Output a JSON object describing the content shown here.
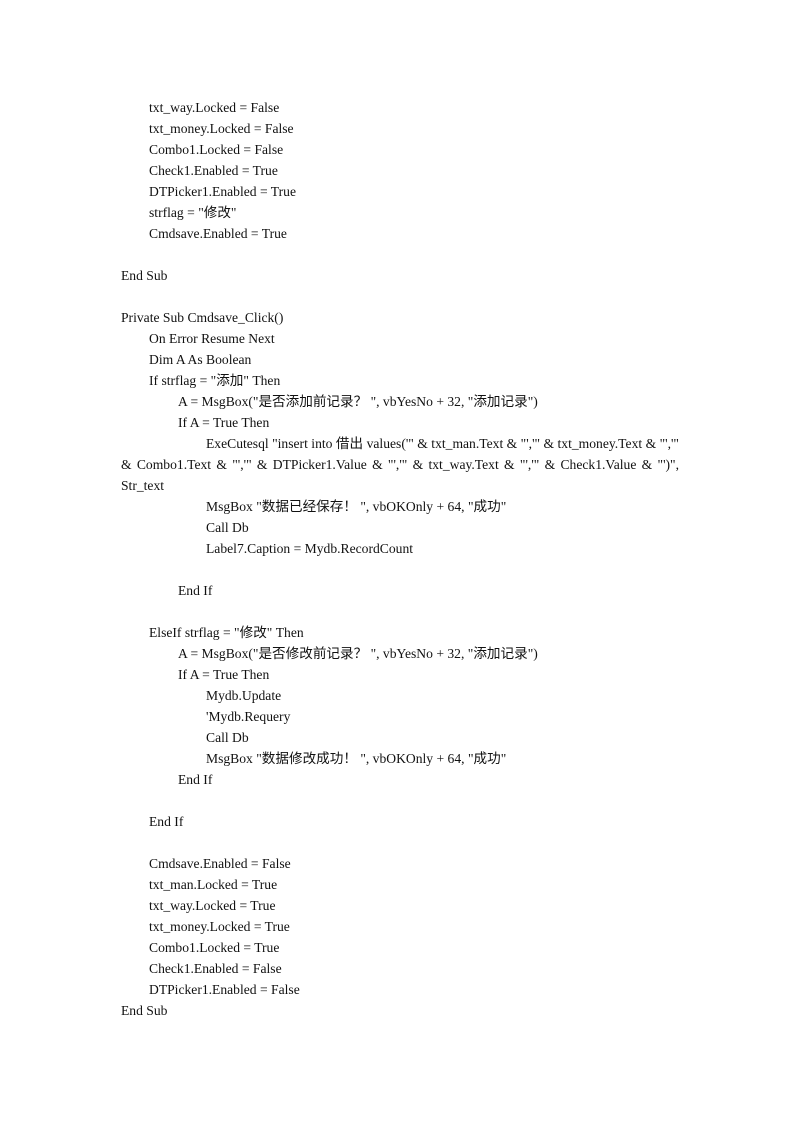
{
  "document": {
    "block1": [
      "txt_way.Locked = False",
      "txt_money.Locked = False",
      "Combo1.Locked = False",
      "Check1.Enabled = True",
      "DTPicker1.Enabled = True",
      "strflag = \"修改\"",
      "Cmdsave.Enabled = True"
    ],
    "end_sub_1": "End Sub",
    "sub_header": "Private Sub Cmdsave_Click()",
    "on_error": "On Error Resume Next",
    "dim_a": "Dim A As Boolean",
    "if_add": "If strflag = \"添加\" Then",
    "msgbox_add_prompt": "A = MsgBox(\"是否添加前记录？ \", vbYesNo + 32, \"添加记录\")",
    "if_a_true_1": "If A = True Then",
    "execute_sql": "ExeCutesql \"insert into  借出  values('\" & txt_man.Text & \"','\" & txt_money.Text & \"','\" & Combo1.Text & \"','\" & DTPicker1.Value & \"','\" & txt_way.Text & \"','\" & Check1.Value & \"')\", Str_text",
    "msgbox_saved": "MsgBox \"数据已经保存！ \", vbOKOnly + 64, \"成功\"",
    "call_db_1": "Call Db",
    "label7_caption": "Label7.Caption = Mydb.RecordCount",
    "end_if_inner_1": "End If",
    "elseif_modify": "ElseIf strflag = \"修改\" Then",
    "msgbox_modify_prompt": "A = MsgBox(\"是否修改前记录？ \", vbYesNo + 32, \"添加记录\")",
    "if_a_true_2": "If A = True Then",
    "mydb_update": "Mydb.Update",
    "mydb_requery_comment": "'Mydb.Requery",
    "call_db_2": "Call Db",
    "msgbox_modified": "MsgBox \"数据修改成功！ \", vbOKOnly + 64, \"成功\"",
    "end_if_inner_2": "End If",
    "end_if_outer": "End If",
    "block2": [
      "Cmdsave.Enabled = False",
      "txt_man.Locked = True",
      "txt_way.Locked = True",
      "txt_money.Locked = True",
      "Combo1.Locked = True",
      "Check1.Enabled = False",
      "DTPicker1.Enabled = False"
    ],
    "end_sub_2": "End Sub"
  }
}
